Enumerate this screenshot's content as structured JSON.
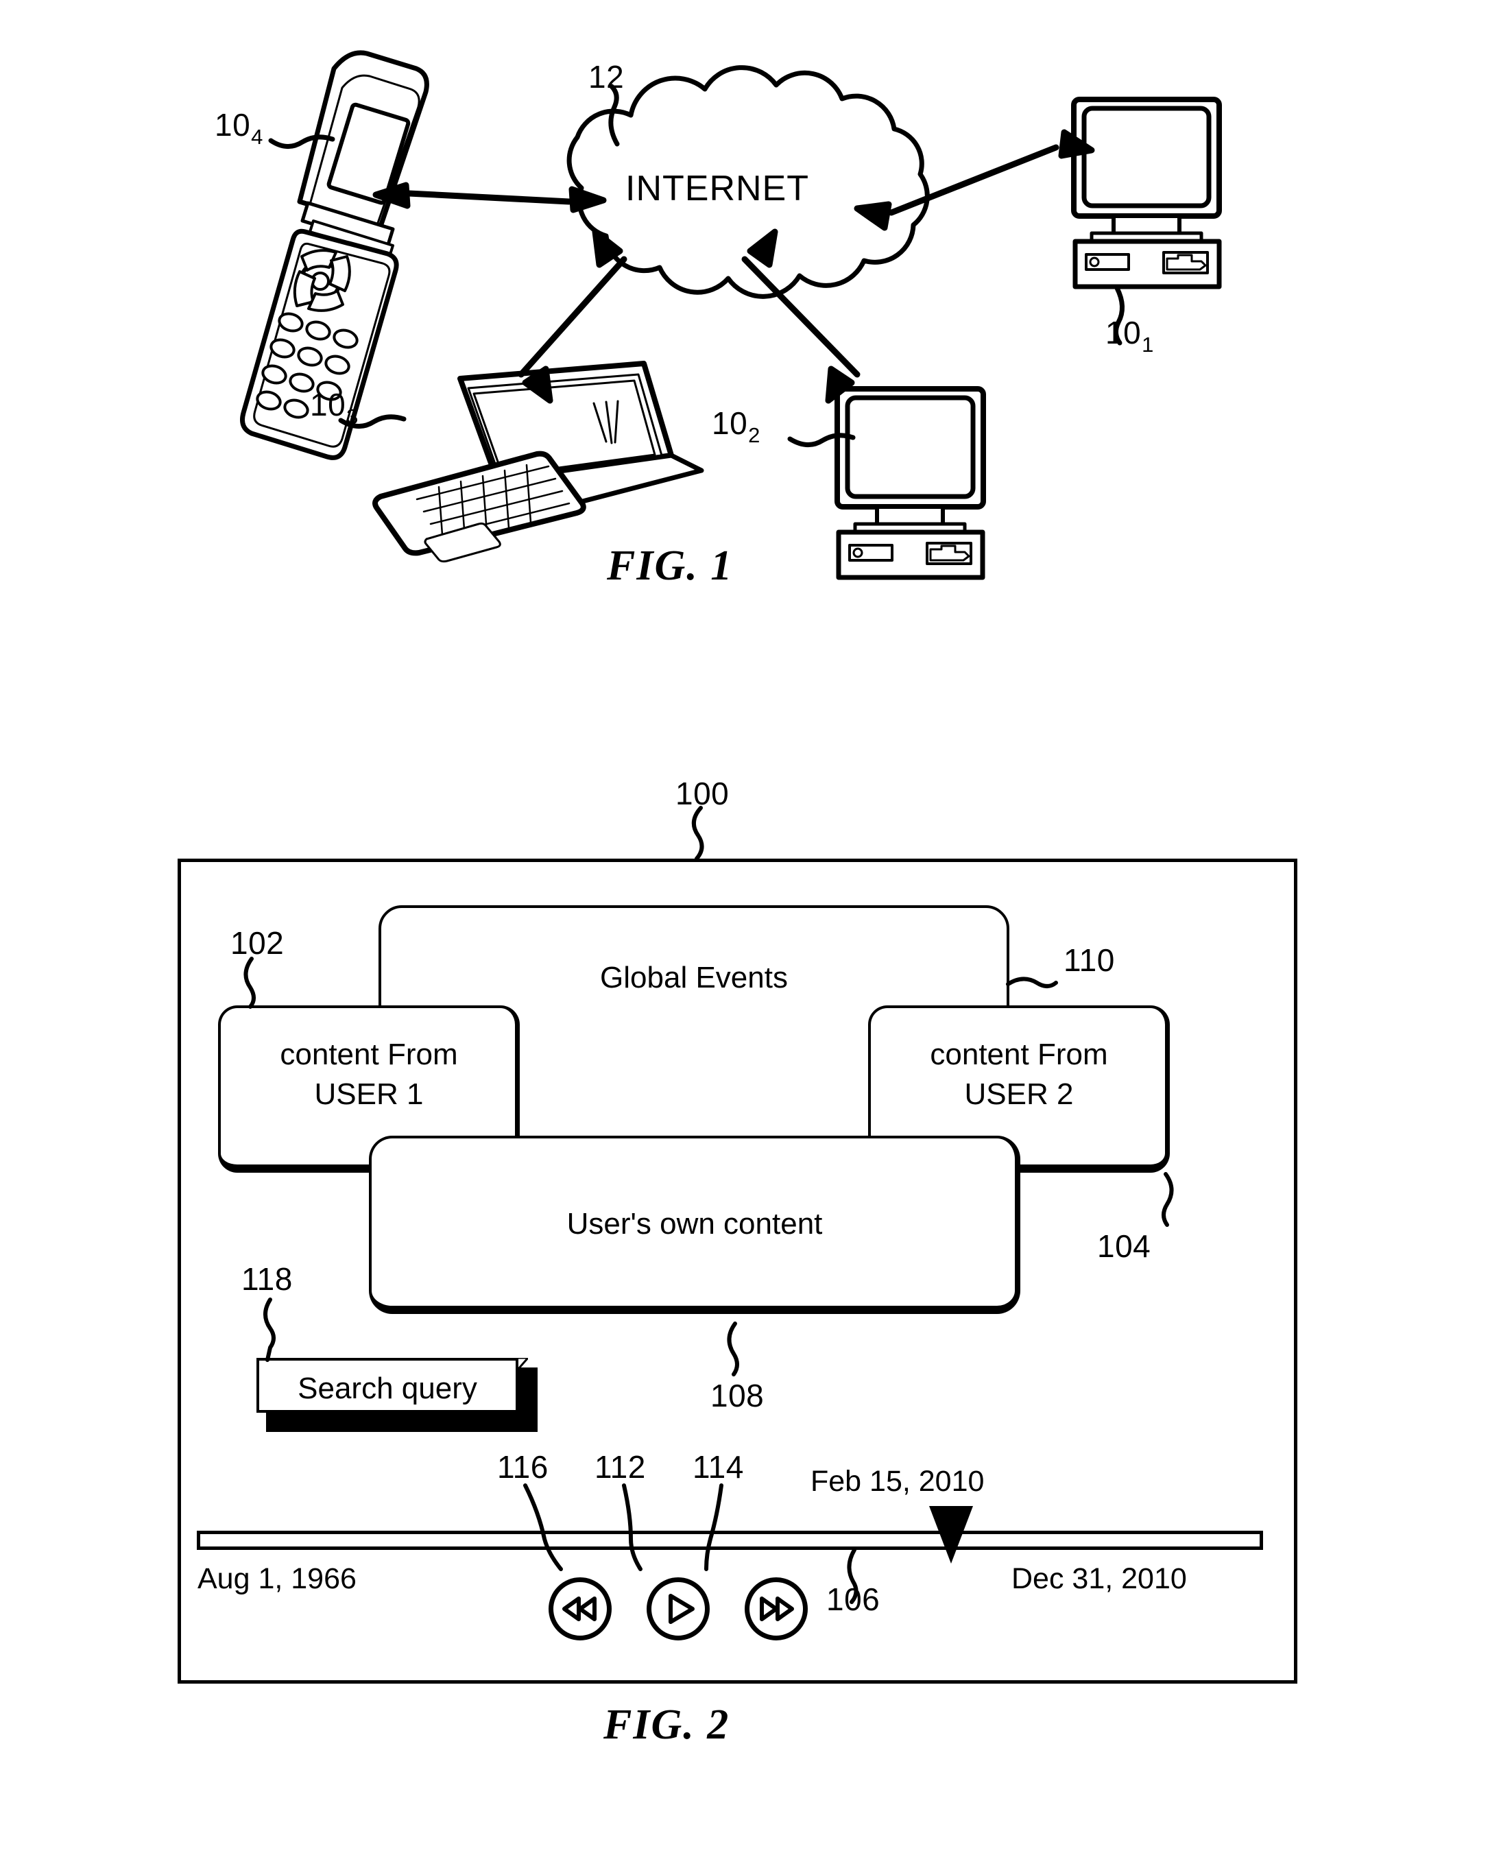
{
  "figure1": {
    "caption": "FIG. 1",
    "network_label": "INTERNET",
    "refs": {
      "internet": "12",
      "mobile_phone": {
        "base": "10",
        "sub": "4"
      },
      "desktop_right": {
        "base": "10",
        "sub": "1"
      },
      "laptop": {
        "base": "10",
        "sub": "3"
      },
      "desktop_bottom": {
        "base": "10",
        "sub": "2"
      }
    },
    "nodes": [
      {
        "name": "mobile-phone",
        "label": "104"
      },
      {
        "name": "desktop-computer-1",
        "label": "101"
      },
      {
        "name": "laptop-computer",
        "label": "103"
      },
      {
        "name": "desktop-computer-2",
        "label": "102"
      }
    ]
  },
  "figure2": {
    "caption": "FIG. 2",
    "refs": {
      "interface": "100",
      "user1_content": "102",
      "user2_content": "104",
      "own_content": "108",
      "global_events": "110",
      "timeline": "106",
      "play_button": "112",
      "forward_button": "114",
      "rewind_button": "116",
      "search_box": "118"
    },
    "boxes": {
      "global_events": "Global Events",
      "user1": "content From\nUSER 1",
      "user1_line1": "content From",
      "user1_line2": "USER 1",
      "user2_line1": "content From",
      "user2_line2": "USER 2",
      "own_content": "User's own content"
    },
    "search": {
      "label": "Search query"
    },
    "timeline": {
      "start_date": "Aug 1, 1966",
      "end_date": "Dec 31, 2010",
      "current_date": "Feb 15, 2010",
      "marker_position_percent": 69
    },
    "controls": [
      {
        "name": "rewind-button",
        "icon": "rewind-icon",
        "ref": "116"
      },
      {
        "name": "play-button",
        "icon": "play-icon",
        "ref": "112"
      },
      {
        "name": "fast-forward-button",
        "icon": "fast-forward-icon",
        "ref": "114"
      }
    ]
  },
  "colors": {
    "ink": "#000000",
    "paper": "#ffffff"
  }
}
